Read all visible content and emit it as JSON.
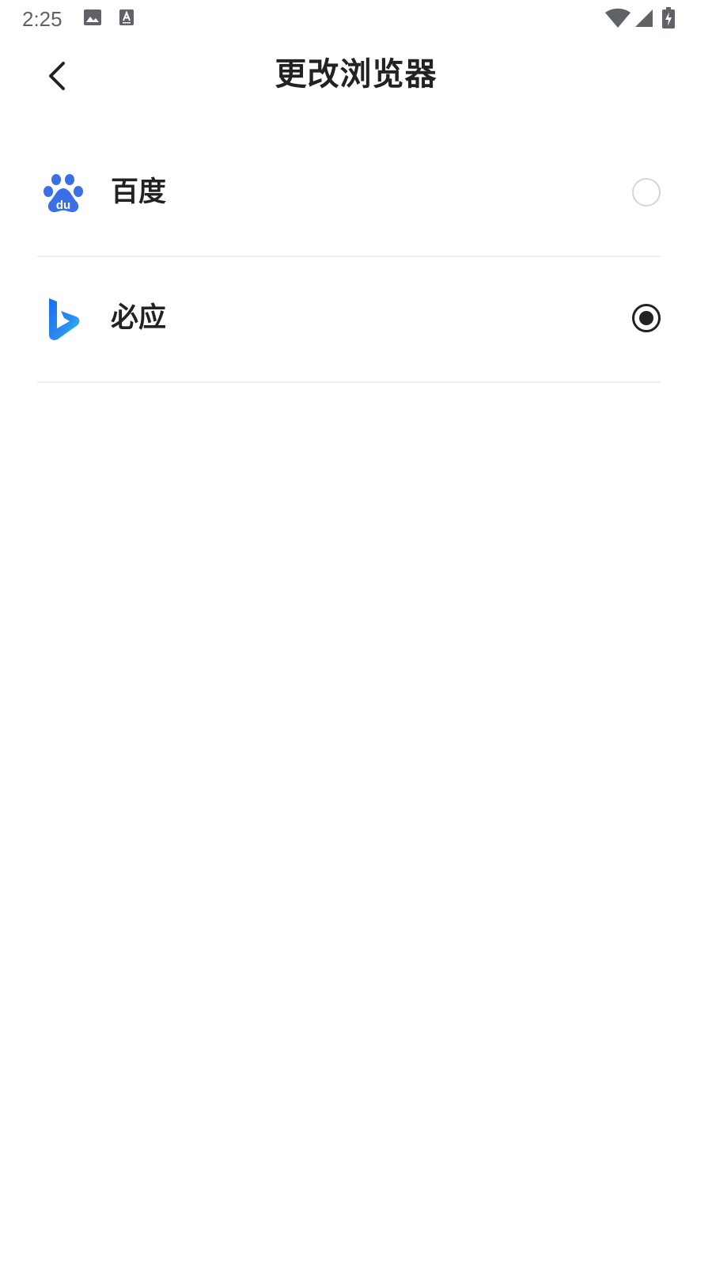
{
  "status_bar": {
    "time": "2:25",
    "icons": [
      "gallery-icon",
      "accessibility-icon",
      "wifi-icon",
      "cellular-signal-icon",
      "battery-charging-icon"
    ]
  },
  "header": {
    "title": "更改浏览器",
    "back_icon": "chevron-left-icon"
  },
  "options": [
    {
      "label": "百度",
      "icon": "baidu-logo-icon",
      "selected": false
    },
    {
      "label": "必应",
      "icon": "bing-logo-icon",
      "selected": true
    }
  ],
  "colors": {
    "text": "#222222",
    "divider": "#eeeeee",
    "radio_unchecked": "#d6d6d6",
    "baidu_blue": "#3b6fe8"
  }
}
